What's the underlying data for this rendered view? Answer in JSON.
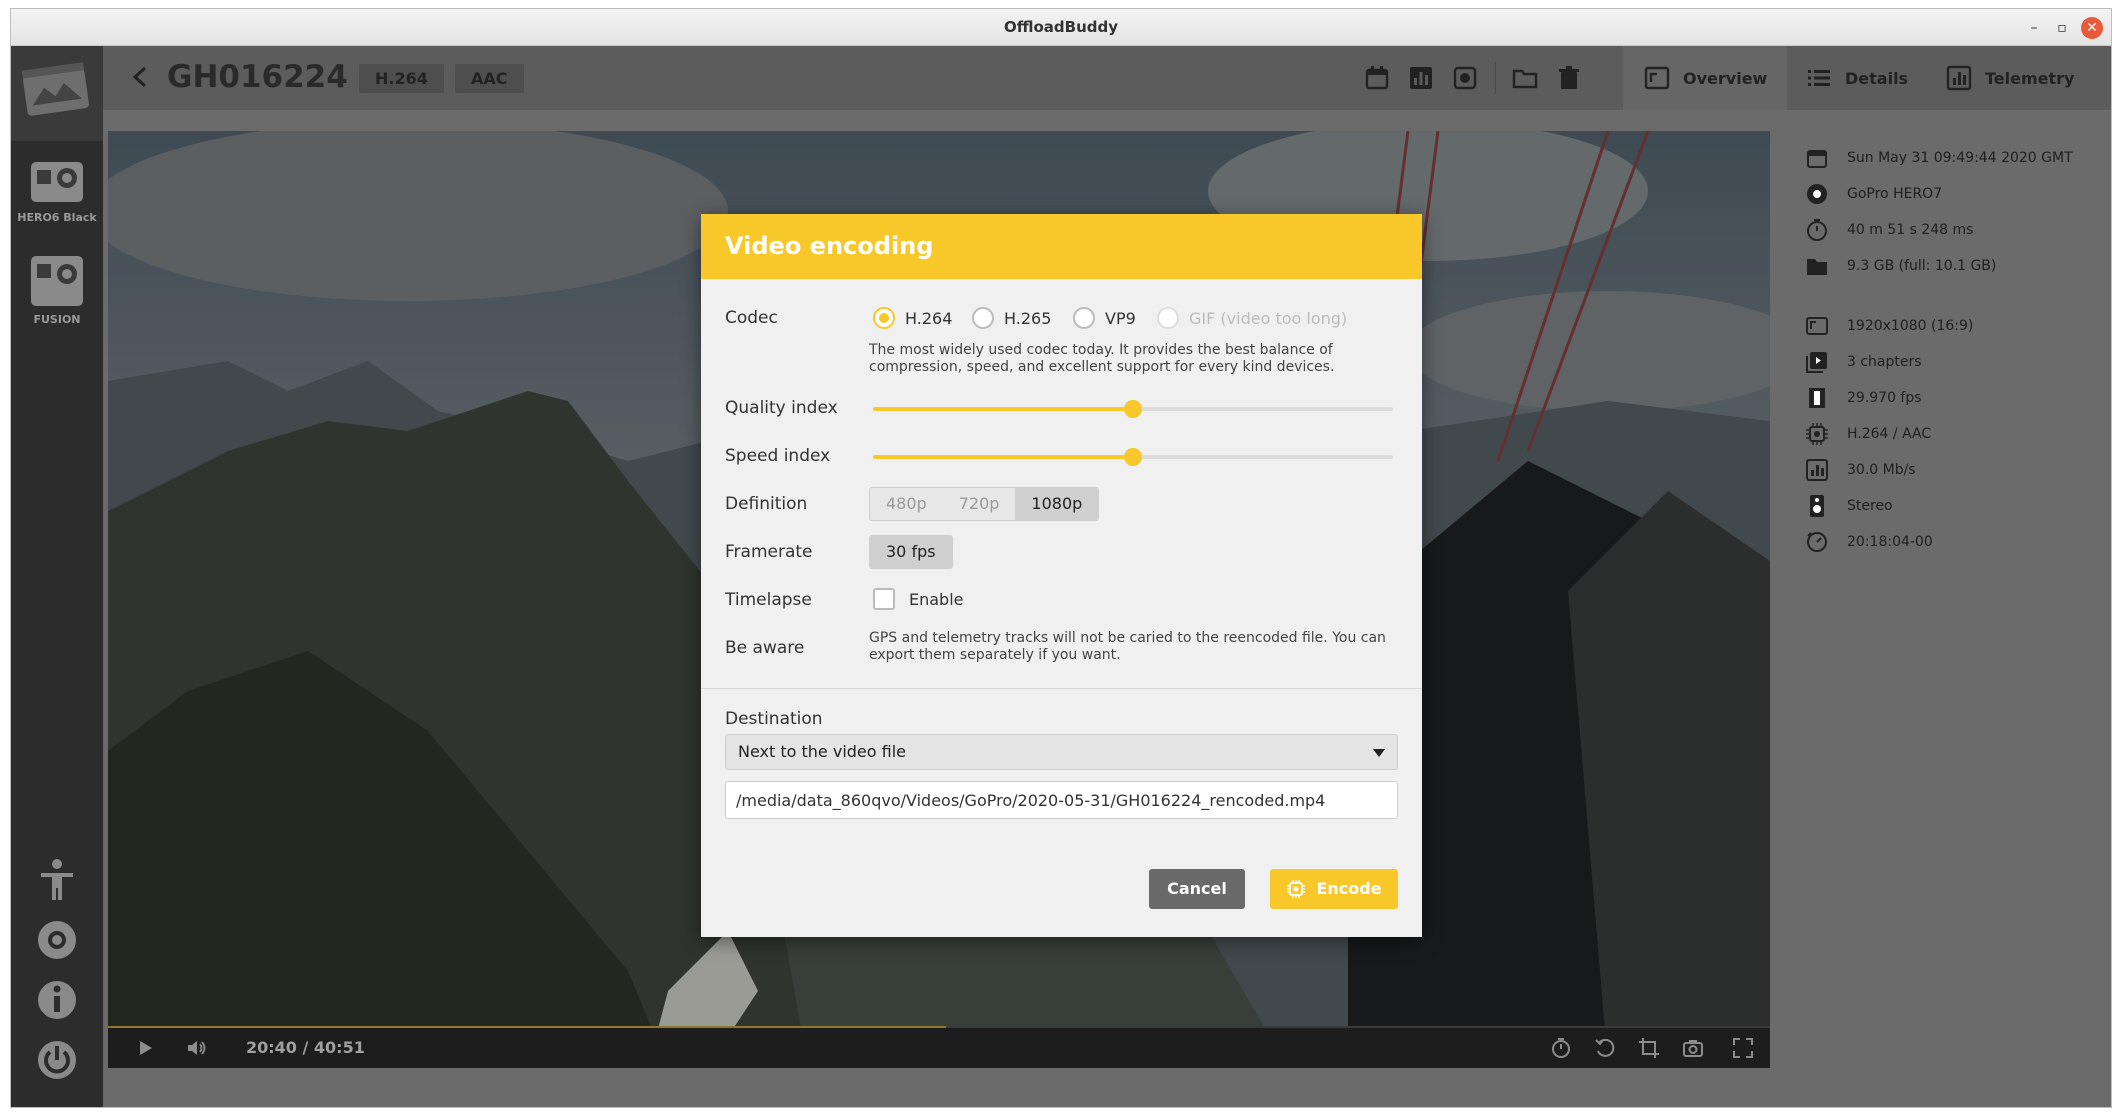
{
  "window": {
    "title": "OffloadBuddy"
  },
  "sidebar": {
    "devices": [
      {
        "label": "HERO6 Black"
      },
      {
        "label": "FUSION"
      }
    ]
  },
  "toolbar": {
    "clip_title": "GH016224",
    "video_codec_chip": "H.264",
    "audio_codec_chip": "AAC",
    "tabs": [
      {
        "label": "Overview"
      },
      {
        "label": "Details"
      },
      {
        "label": "Telemetry"
      }
    ]
  },
  "player": {
    "time": "20:40 / 40:51",
    "progress": 0.504
  },
  "info": {
    "date": "Sun May 31 09:49:44 2020 GMT",
    "camera": "GoPro HERO7",
    "duration": "40 m 51 s 248 ms",
    "size": "9.3 GB   (full: 10.1 GB)",
    "resolution": "1920x1080   (16:9)",
    "chapters": "3 chapters",
    "framerate": "29.970 fps",
    "codecs": "H.264 / AAC",
    "bitrate": "30.0 Mb/s",
    "audio": "Stereo",
    "timecode": "20:18:04-00"
  },
  "dialog": {
    "title": "Video encoding",
    "codec_label": "Codec",
    "codec_options": [
      {
        "label": "H.264",
        "selected": true,
        "disabled": false
      },
      {
        "label": "H.265",
        "selected": false,
        "disabled": false
      },
      {
        "label": "VP9",
        "selected": false,
        "disabled": false
      },
      {
        "label": "GIF (video too long)",
        "selected": false,
        "disabled": true
      }
    ],
    "codec_description": "The most widely used codec today. It provides the best balance of compression, speed, and excellent support for every kind devices.",
    "quality_label": "Quality index",
    "quality_value": 0.5,
    "speed_label": "Speed index",
    "speed_value": 0.5,
    "definition_label": "Definition",
    "definition_options": [
      "480p",
      "720p",
      "1080p"
    ],
    "definition_selected": "1080p",
    "framerate_label": "Framerate",
    "framerate_value": "30 fps",
    "timelapse_label": "Timelapse",
    "timelapse_checkbox": "Enable",
    "aware_label": "Be aware",
    "aware_text": "GPS and telemetry tracks will not be caried to the reencoded file. You can export them separately if you want.",
    "destination_label": "Destination",
    "destination_select": "Next to the video file",
    "destination_path": "/media/data_860qvo/Videos/GoPro/2020-05-31/GH016224_rencoded.mp4",
    "cancel_label": "Cancel",
    "encode_label": "Encode"
  },
  "colors": {
    "accent": "#f8c72a",
    "sidebar": "#2c2c2c",
    "toolbar": "#5c5c5c"
  }
}
